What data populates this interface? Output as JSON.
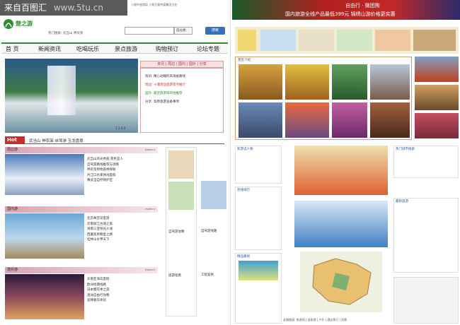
{
  "watermark": {
    "site_name": "来自百图汇",
    "url": "www.5tu.cn"
  },
  "left_page": {
    "topline": "十堰市旅游局 十堰日报传媒集团主办",
    "logo_text": "楚之游",
    "hot_search": "热门搜索: 武当山 神农架",
    "search_select": "选分类",
    "search_button": "搜索",
    "nav": [
      {
        "label": "首 页"
      },
      {
        "label": "新闻资讯"
      },
      {
        "label": "吃喝玩乐"
      },
      {
        "label": "景点旅游"
      },
      {
        "label": "购物预订"
      },
      {
        "label": "论坛专题"
      }
    ],
    "hero_pages": "1 2 3 4",
    "tabs": "资讯 | 周边 | 国内 | 国外 | 分享",
    "news": [
      {
        "text": "资讯: 精心动魄的高海拔路线"
      },
      {
        "text": "周边: 十堰周边旅游景点推介"
      },
      {
        "text": "国外: 最佳旅游目的地推荐"
      },
      {
        "text": "分享: 高原旅游准备事项"
      }
    ],
    "hot_label": "Hot",
    "hot_links": "武当山   神农架   自驾游   玉龙盘景",
    "sections": [
      {
        "title": "周边游",
        "more": "more>>"
      },
      {
        "title": "国内游",
        "more": "more>>"
      },
      {
        "title": "境外游",
        "more": "more>>"
      }
    ],
    "col_mid": {
      "title1": "自驾游攻略",
      "title2": "旅游指南"
    },
    "col_right": {
      "title1": "自驾游线路",
      "title2": "工程案例"
    }
  },
  "right_page": {
    "banner_line1": "自由行 · 微团购",
    "banner_line2": "国内旅游全线产品最低399元 锦绣山游价格更实惠",
    "gallery_title": "景区介绍",
    "news_title": "新游记人物",
    "ranking_title": "热线排行",
    "map_title": "精品路线",
    "side_title": "热门城市搜索",
    "side_title2": "最新旅游",
    "footer": "友情链接: 旅游网 | 自助游 | 户外 | 酒店预订 | 机票"
  },
  "colors": {
    "brand_green": "#2f8f2f",
    "hot_red": "#c03030",
    "accent_pink": "#d8a2b5"
  }
}
